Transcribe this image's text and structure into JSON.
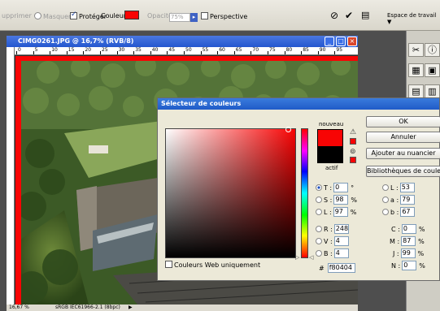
{
  "options_bar": {
    "supprimer": "upprimer",
    "masquer": "Masquer",
    "proteger": "Protéger",
    "couleur_label": "Couleur :",
    "couleur_hex": "#f80404",
    "opacite_label": "Opacité :",
    "opacite_value": "75%",
    "perspective": "Perspective",
    "workspace": "Espace de travail ▼"
  },
  "icons": {
    "cancel": "cancel-icon",
    "commit": "checkmark-icon",
    "palette": "palette-icon"
  },
  "document": {
    "title": "CIMG0261.JPG @ 16,7% (RVB/8)",
    "ruler_marks": [
      "0",
      "5",
      "10",
      "15",
      "20",
      "25",
      "30",
      "35",
      "40",
      "45",
      "50",
      "55",
      "60",
      "65",
      "70",
      "75",
      "80",
      "85",
      "90",
      "95"
    ],
    "status_zoom": "16,67 %",
    "status_profile": "sRGB IEC61966-2.1 (8bpc)",
    "status_arrow": "▶"
  },
  "picker": {
    "title": "Sélecteur de couleurs",
    "nouveau": "nouveau",
    "actuel": "actif",
    "new_color": "#f80404",
    "current_color": "#000000",
    "buttons": {
      "ok": "OK",
      "annuler": "Annuler",
      "ajouter": "Ajouter au nuancier",
      "bibliotheques": "Bibliothèques de couleurs"
    },
    "hsb": [
      {
        "label": "T :",
        "value": "0",
        "unit": "°"
      },
      {
        "label": "S :",
        "value": "98",
        "unit": "%"
      },
      {
        "label": "L :",
        "value": "97",
        "unit": "%"
      }
    ],
    "rgb": [
      {
        "label": "R :",
        "value": "248"
      },
      {
        "label": "V :",
        "value": "4"
      },
      {
        "label": "B :",
        "value": "4"
      }
    ],
    "lab": [
      {
        "label": "L :",
        "value": "53"
      },
      {
        "label": "a :",
        "value": "79"
      },
      {
        "label": "b :",
        "value": "67"
      }
    ],
    "cmyk": [
      {
        "label": "C :",
        "value": "0",
        "unit": "%"
      },
      {
        "label": "M :",
        "value": "87",
        "unit": "%"
      },
      {
        "label": "J :",
        "value": "99",
        "unit": "%"
      },
      {
        "label": "N :",
        "value": "0",
        "unit": "%"
      }
    ],
    "hex_label": "#",
    "hex_value": "f80404",
    "web_only": "Couleurs Web uniquement"
  }
}
